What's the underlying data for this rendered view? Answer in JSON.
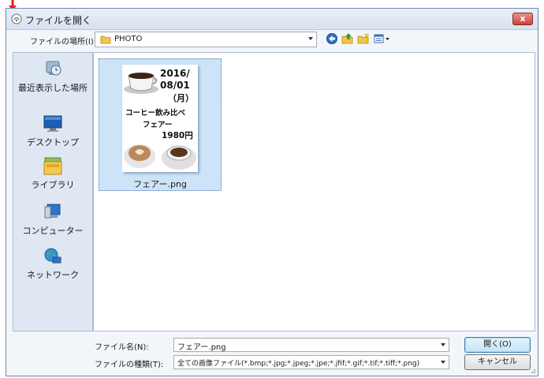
{
  "window": {
    "title": "ファイルを開く",
    "close_label": "x"
  },
  "toolbar": {
    "lookin_label": "ファイルの場所(I):",
    "lookin_value": "PHOTO",
    "back_icon": "back-arrow-icon",
    "up_icon": "up-folder-icon",
    "new_folder_icon": "new-folder-icon",
    "views_icon": "views-menu-icon"
  },
  "places": [
    {
      "label": "最近表示した場所",
      "icon": "recent-places-icon"
    },
    {
      "label": "デスクトップ",
      "icon": "desktop-icon"
    },
    {
      "label": "ライブラリ",
      "icon": "libraries-icon"
    },
    {
      "label": "コンピューター",
      "icon": "computer-icon"
    },
    {
      "label": "ネットワーク",
      "icon": "network-icon"
    }
  ],
  "files": [
    {
      "name": "フェアー.png",
      "thumbnail_text": {
        "date_line1": "2016/",
        "date_line2": "08/01",
        "day": "（月）",
        "line1": "コーヒー飲み比べ",
        "line2": "フェアー",
        "price": "1980円"
      }
    }
  ],
  "filename": {
    "label": "ファイル名(N):",
    "value": "フェアー.png"
  },
  "filetype": {
    "label": "ファイルの種類(T):",
    "value": "全ての画像ファイル(*.bmp;*.jpg;*.jpeg;*.jpe;*.jfif;*.gif;*.tif;*.tiff;*.png)"
  },
  "buttons": {
    "open": "開く(O)",
    "cancel": "キャンセル"
  },
  "colors": {
    "accent_arrow": "#e8201a",
    "selection_bg": "#cde3f7",
    "places_bg": "#dfe7f2"
  }
}
